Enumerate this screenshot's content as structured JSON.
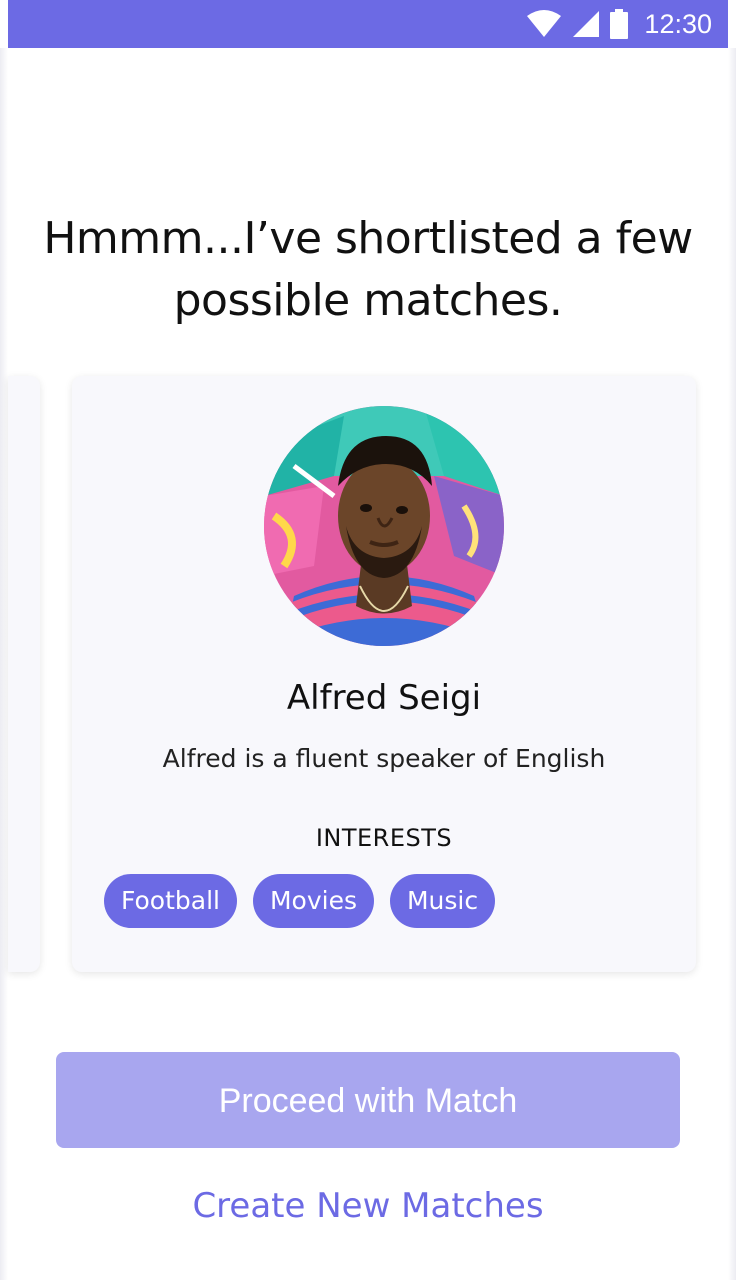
{
  "status_bar": {
    "time": "12:30",
    "icons": [
      "wifi-icon",
      "cellular-signal-icon",
      "battery-icon"
    ],
    "color": "#6c6ae4"
  },
  "headline": "Hmmm...I’ve shortlisted a few possible matches.",
  "match_card": {
    "name": "Alfred Seigi",
    "bio": "Alfred is a fluent speaker of English",
    "interests_label": "INTERESTS",
    "interests": [
      "Football",
      "Movies",
      "Music"
    ]
  },
  "actions": {
    "proceed_label": "Proceed with Match",
    "create_label": "Create New Matches"
  },
  "colors": {
    "accent": "#6c6ae4",
    "accent_disabled": "#a8a6ef",
    "card_background": "#f8f8fc"
  }
}
